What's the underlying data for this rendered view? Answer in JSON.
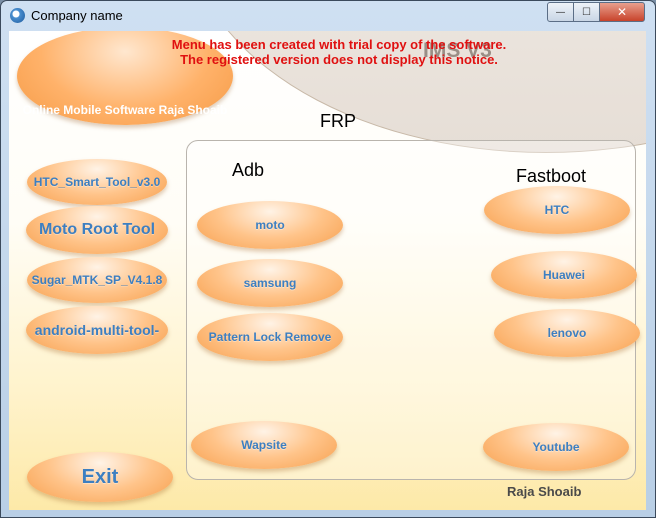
{
  "window": {
    "title": "Company name",
    "controls": {
      "minimize": "—",
      "maximize": "☐",
      "close": "✕"
    }
  },
  "branding": {
    "oval_text": "Online Mobile Software Raja Shoaib",
    "product": "IMS V3",
    "owner": "Raja Shoaib"
  },
  "notice": {
    "line1": "Menu has been created with trial copy of the software.",
    "line2": "The registered version does not display this notice."
  },
  "section_title": "FRP",
  "left_menu": [
    "HTC_Smart_Tool_v3.0",
    "Moto Root Tool",
    "Sugar_MTK_SP_V4.1.8",
    "android-multi-tool-"
  ],
  "exit_label": "Exit",
  "adb": {
    "heading": "Adb",
    "buttons": [
      "moto",
      "samsung",
      "Pattern Lock Remove",
      "Wapsite"
    ]
  },
  "fastboot": {
    "heading": "Fastboot",
    "buttons": [
      "HTC",
      "Huawei",
      "lenovo",
      "Youtube"
    ]
  },
  "colors": {
    "notice_red": "#e01010",
    "button_text_blue": "#3d7fc1",
    "button_orange": "#f7a04e"
  }
}
